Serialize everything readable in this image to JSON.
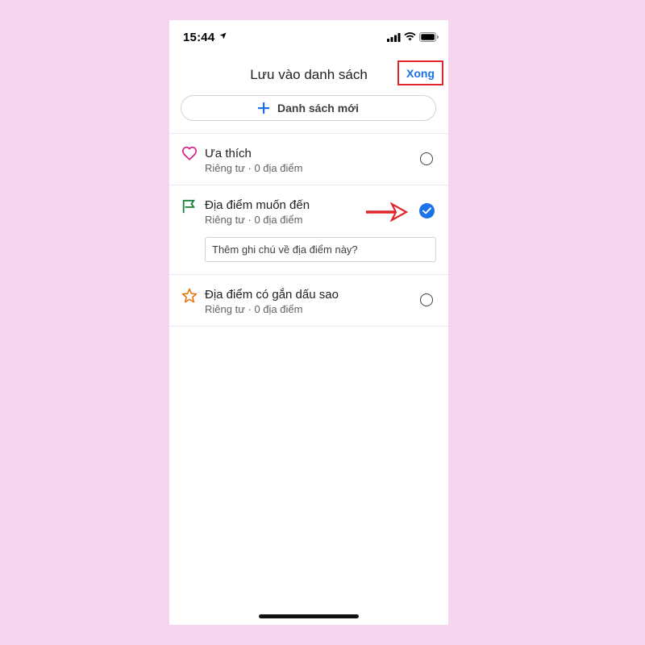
{
  "status_bar": {
    "time": "15:44"
  },
  "header": {
    "title": "Lưu vào danh sách",
    "done_label": "Xong"
  },
  "new_list": {
    "label": "Danh sách mới"
  },
  "lists": [
    {
      "name": "Ưa thích",
      "meta": "Riêng tư · 0 địa điểm",
      "icon": "heart-icon",
      "icon_color": "#d81b8a",
      "checked": false
    },
    {
      "name": "Địa điểm muốn đến",
      "meta": "Riêng tư · 0 địa điểm",
      "icon": "flag-icon",
      "icon_color": "#188038",
      "checked": true
    },
    {
      "name": "Địa điểm có gắn dấu sao",
      "meta": "Riêng tư · 0 địa điểm",
      "icon": "star-icon",
      "icon_color": "#e8710a",
      "checked": false
    }
  ],
  "note": {
    "placeholder": "Thêm ghi chú về địa điểm này?"
  },
  "colors": {
    "accent": "#1a73e8",
    "highlight": "#e0262b",
    "background": "#f6d6ee"
  }
}
